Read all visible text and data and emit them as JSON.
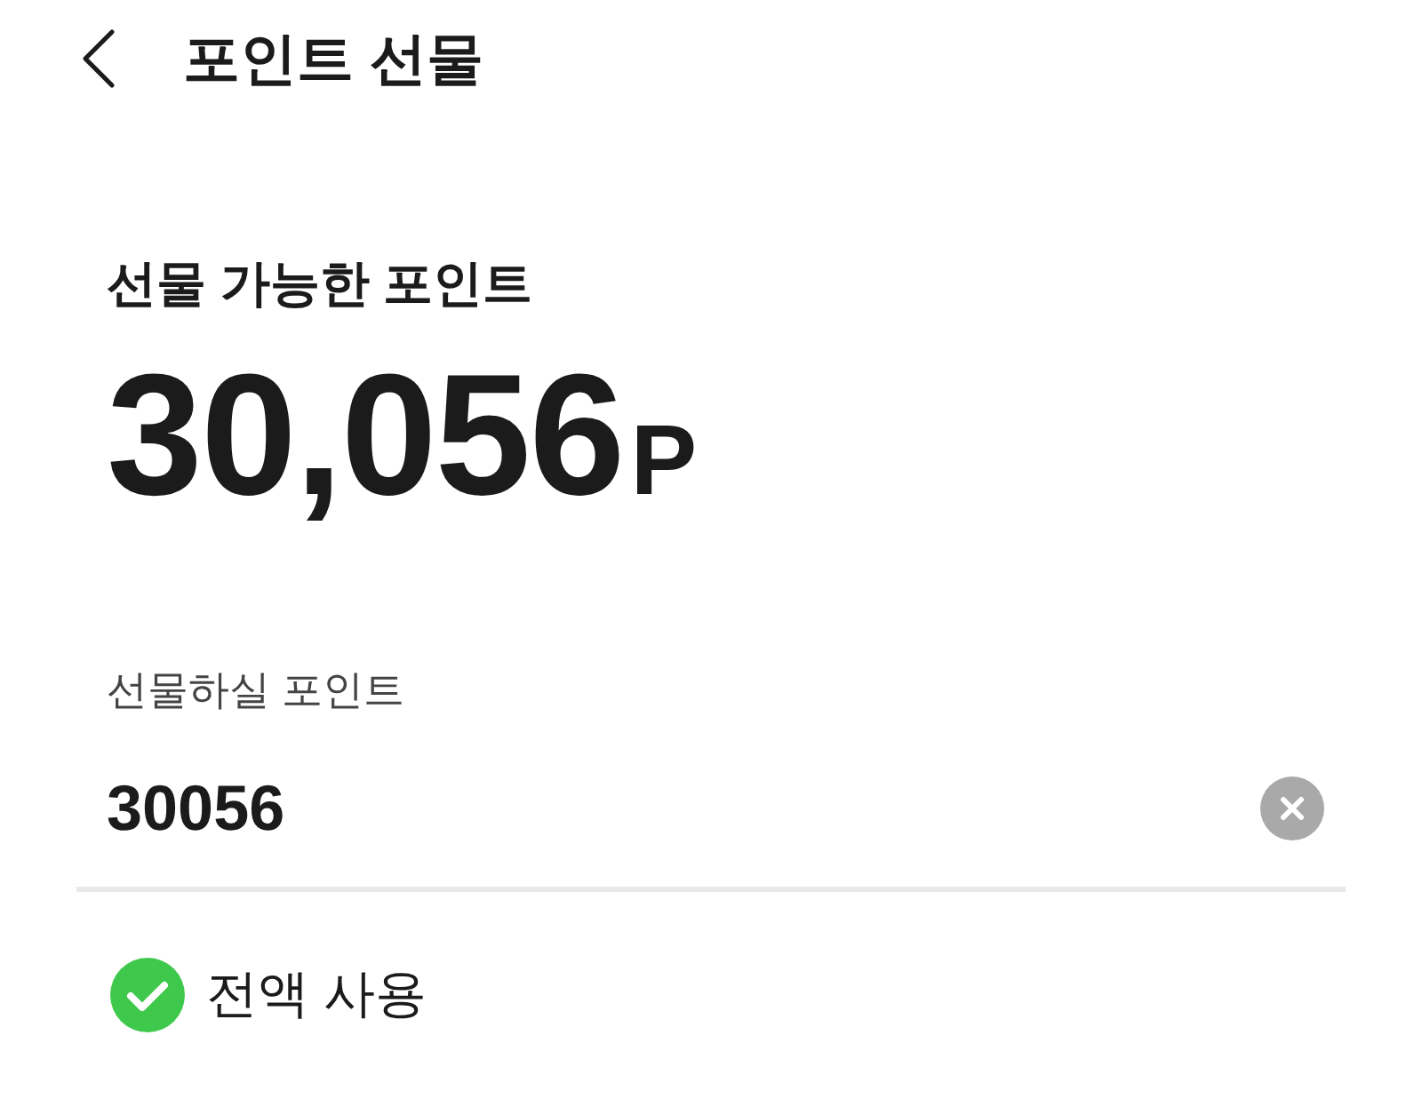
{
  "header": {
    "title": "포인트 선물"
  },
  "available": {
    "label": "선물 가능한 포인트",
    "amount": "30,056",
    "unit": "P"
  },
  "gift_input": {
    "label": "선물하실 포인트",
    "value": "30056"
  },
  "full_amount": {
    "label": "전액 사용",
    "checked": true
  }
}
